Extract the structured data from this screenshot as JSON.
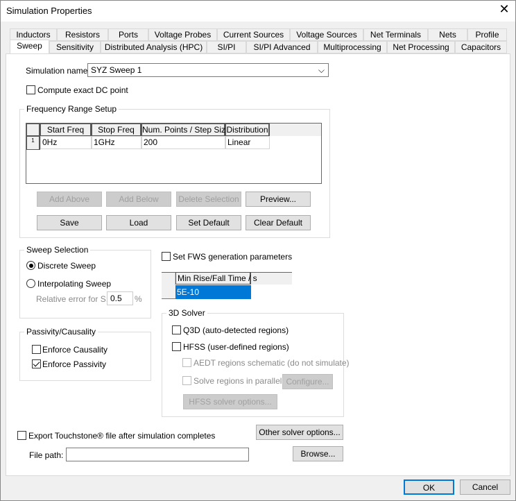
{
  "window": {
    "title": "Simulation Properties",
    "close_icon": "close-icon"
  },
  "tabs_row1": [
    "Inductors",
    "Resistors",
    "Ports",
    "Voltage Probes",
    "Current Sources",
    "Voltage Sources",
    "Net Terminals",
    "Nets",
    "Profile"
  ],
  "tabs_row2": [
    "Sweep",
    "Sensitivity",
    "Distributed Analysis (HPC)",
    "SI/PI",
    "SI/PI Advanced",
    "Multiprocessing",
    "Net Processing",
    "Capacitors"
  ],
  "active_tab": "Sweep",
  "sweep": {
    "sim_name_label": "Simulation name:",
    "sim_name_value": "SYZ Sweep 1",
    "compute_dc": {
      "label": "Compute exact DC point",
      "checked": false
    },
    "freq_group": "Frequency Range Setup",
    "table": {
      "headers": [
        "Start Freq",
        "Stop Freq",
        "Num. Points / Step Size",
        "Distribution"
      ],
      "rows": [
        {
          "index": "1",
          "cells": [
            "0Hz",
            "1GHz",
            "200",
            "Linear"
          ]
        }
      ]
    },
    "buttons": {
      "add_above": "Add Above",
      "add_below": "Add Below",
      "delete_selection": "Delete Selection",
      "preview": "Preview...",
      "save": "Save",
      "load": "Load",
      "set_default": "Set Default",
      "clear_default": "Clear Default"
    },
    "sweep_selection": {
      "title": "Sweep Selection",
      "discrete": "Discrete Sweep",
      "interpolating": "Interpolating Sweep",
      "selected": "Discrete Sweep",
      "rel_error_label": "Relative error for S:",
      "rel_error_value": "0.5",
      "rel_error_unit": "%"
    },
    "passivity": {
      "title": "Passivity/Causality",
      "causality": {
        "label": "Enforce Causality",
        "checked": false
      },
      "passivity": {
        "label": "Enforce Passivity",
        "checked": true
      }
    },
    "fws": {
      "label": "Set FWS generation parameters",
      "checked": false,
      "header": "Min Rise/Fall Time / s",
      "value": "5E-10"
    },
    "solver3d": {
      "title": "3D Solver",
      "q3d": "Q3D (auto-detected regions)",
      "hfss": "HFSS (user-defined regions)",
      "aedt": "AEDT regions schematic (do not simulate)",
      "parallel": "Solve regions in parallel",
      "configure": "Configure...",
      "hfss_options": "HFSS solver options..."
    },
    "export": {
      "label": "Export Touchstone® file after simulation completes",
      "checked": false,
      "file_path_label": "File path:",
      "file_path_value": "",
      "browse": "Browse...",
      "other_solver": "Other solver options..."
    }
  },
  "footer": {
    "ok": "OK",
    "cancel": "Cancel"
  }
}
